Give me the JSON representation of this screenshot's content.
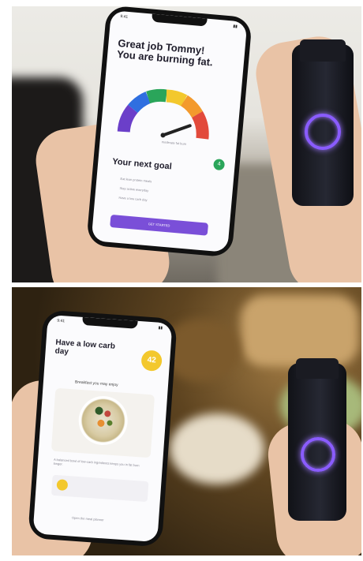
{
  "top_screen": {
    "status_time": "9:41",
    "headline": "Great job Tommy! You are burning fat.",
    "gauge_caption": "moderate fat burn",
    "next_goal_title": "Your next goal",
    "goal_badge": "4",
    "goals": [
      "Eat lean protein meals",
      "Stay active everyday",
      "Have a low carb day"
    ],
    "cta_label": "GET STARTED"
  },
  "bottom_screen": {
    "status_time": "9:41",
    "headline": "Have a low carb day",
    "score_badge": "42",
    "subtitle": "Breakfast you may enjoy",
    "tip_text": "A balanced bowl of low-carb ingredients keeps you in fat burn longer.",
    "footer_label": "Open the meal planner"
  },
  "colors": {
    "accent_purple": "#7a4fd8",
    "ring_glow": "#8a5cff",
    "score_yellow": "#f3c82d",
    "goal_green": "#2aa55a"
  }
}
